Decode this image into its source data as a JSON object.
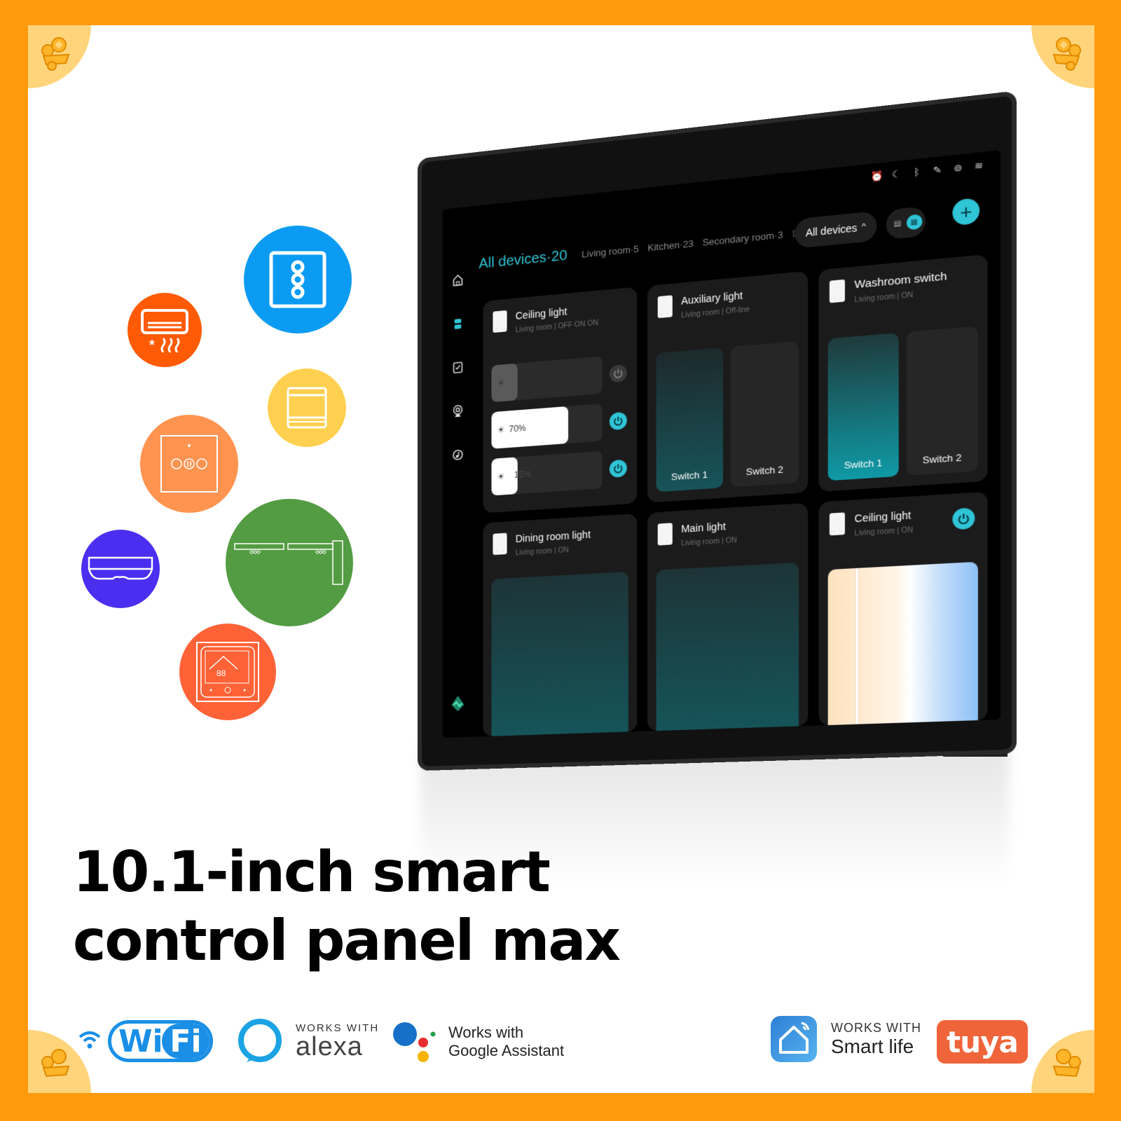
{
  "headline": {
    "line1": "10.1-inch smart",
    "line2": "control panel max"
  },
  "theme": {
    "frame_orange": "#ff9a0d",
    "accent_cyan": "#2fc4d6"
  },
  "device_bubbles": [
    {
      "name": "air-conditioner",
      "color": "#ff5a05"
    },
    {
      "name": "triple-switch",
      "color": "#0b9bf2"
    },
    {
      "name": "curtain-motor",
      "color": "#ffd050"
    },
    {
      "name": "curtain-switch",
      "color": "#ff9350"
    },
    {
      "name": "gateway-hub",
      "color": "#4a2ff0"
    },
    {
      "name": "curtain-track",
      "color": "#539c43"
    },
    {
      "name": "thermostat",
      "color": "#ff6237"
    }
  ],
  "panel": {
    "status_icons": [
      "alarm-icon",
      "moon-icon",
      "bluetooth-icon",
      "mic-off-icon",
      "location-icon",
      "wifi-icon"
    ],
    "sidebar": [
      "home-icon",
      "devices-icon",
      "scenes-icon",
      "camera-icon",
      "music-icon"
    ],
    "tabs": {
      "active": "All devices·20",
      "items": [
        "Living room·5",
        "Kitchen·23",
        "Secondary room·3"
      ],
      "overflow": "Dini"
    },
    "filter_pill": "All devices",
    "add_label": "+",
    "cards": [
      {
        "name": "Ceiling light",
        "sub": "Living room | OFF ON ON",
        "sliders": [
          {
            "value_pct": null,
            "label": "",
            "on": false
          },
          {
            "value_pct": 70,
            "label": "70%",
            "on": true
          },
          {
            "value_pct": 15,
            "label": "15%",
            "on": true
          }
        ]
      },
      {
        "name": "Auxiliary light",
        "sub": "Living room | Off-line",
        "switches": [
          {
            "label": "Switch 1",
            "state": "on"
          },
          {
            "label": "Switch 2",
            "state": "off"
          }
        ]
      },
      {
        "name": "Washroom switch",
        "sub": "Living room | ON",
        "switches": [
          {
            "label": "Switch 1",
            "state": "on"
          },
          {
            "label": "Switch 2",
            "state": "off"
          }
        ]
      },
      {
        "name": "Dining room light",
        "sub": "Living room | ON"
      },
      {
        "name": "Main light",
        "sub": "Living room | ON"
      },
      {
        "name": "Ceiling light",
        "sub": "Living room | ON",
        "power_on": true
      }
    ]
  },
  "logos": {
    "wifi": {
      "wi": "Wi",
      "fi": "Fi"
    },
    "alexa": {
      "top": "WORKS WITH",
      "bottom": "alexa"
    },
    "google": {
      "line1": "Works with",
      "line2": "Google Assistant"
    },
    "smartlife": {
      "top": "WORKS WITH",
      "bottom": "Smart life"
    },
    "tuya": "tuya"
  }
}
